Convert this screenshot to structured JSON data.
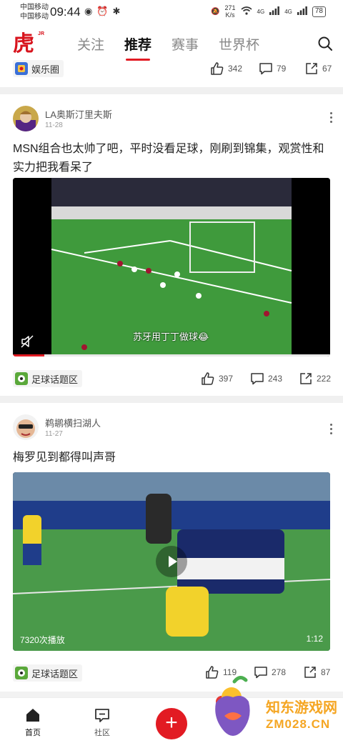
{
  "status_bar": {
    "carrier_1": "中国移动",
    "carrier_2": "中国移动",
    "time": "09:44",
    "net_speed_value": "271",
    "net_speed_unit": "K/s",
    "signal_label_1": "4G",
    "signal_label_2": "4G",
    "battery": "78"
  },
  "app": {
    "logo_text": "虎扑",
    "logo_sub": "JR",
    "brand_color": "#e21b23"
  },
  "tabs": [
    {
      "label": "关注",
      "active": false
    },
    {
      "label": "推荐",
      "active": true
    },
    {
      "label": "赛事",
      "active": false
    },
    {
      "label": "世界杯",
      "active": false
    }
  ],
  "top_partial": {
    "tag": "娱乐圈",
    "likes": "342",
    "comments": "79",
    "shares": "67"
  },
  "posts": [
    {
      "author": "LA奥斯汀里夫斯",
      "date": "11-28",
      "text": "MSN组合也太帅了吧，平时没看足球，刚刷到锦集，观赏性和实力把我看呆了",
      "video_caption": "苏牙用丁丁做球😂",
      "video_progress": 0.1,
      "tag": "足球话题区",
      "likes": "397",
      "comments": "243",
      "shares": "222"
    },
    {
      "author": "鹈鹕横扫湖人",
      "date": "11-27",
      "text": "梅罗见到都得叫声哥",
      "play_count": "7320次播放",
      "duration": "1:12",
      "tag": "足球话题区",
      "likes": "119",
      "comments": "278",
      "shares": "87"
    }
  ],
  "bottom_nav": {
    "home": "首页",
    "community": "社区",
    "add": "+"
  },
  "watermark": {
    "title": "知东游戏网",
    "url": "ZM028.CN"
  }
}
